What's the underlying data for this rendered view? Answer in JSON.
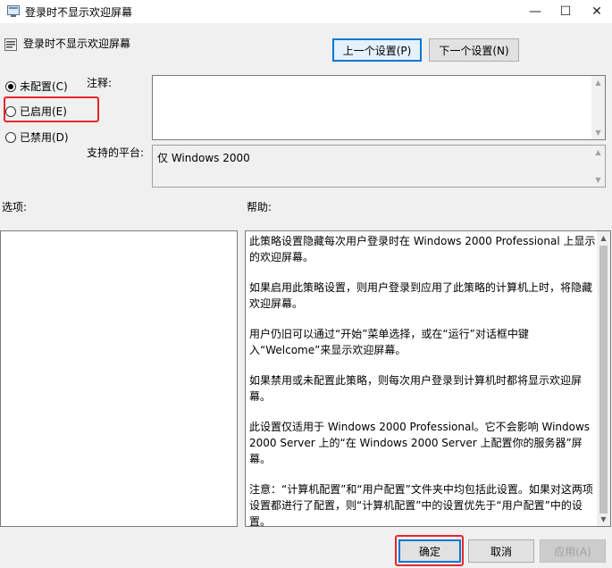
{
  "window": {
    "title": "登录时不显示欢迎屏幕",
    "controls": {
      "minimize": "—",
      "maximize": "☐",
      "close": "✕"
    }
  },
  "header": {
    "title": "登录时不显示欢迎屏幕"
  },
  "nav": {
    "prev_label": "上一个设置(P)",
    "next_label": "下一个设置(N)"
  },
  "state": {
    "options": [
      {
        "label": "未配置(C)",
        "checked": true
      },
      {
        "label": "已启用(E)",
        "checked": false
      },
      {
        "label": "已禁用(D)",
        "checked": false
      }
    ]
  },
  "labels": {
    "comment": "注释:",
    "platform": "支持的平台:",
    "options": "选项:",
    "help": "帮助:"
  },
  "platform": {
    "value": "仅 Windows 2000"
  },
  "help": {
    "paragraphs": [
      "此策略设置隐藏每次用户登录时在 Windows 2000 Professional 上显示的欢迎屏幕。",
      "如果启用此策略设置，则用户登录到应用了此策略的计算机上时，将隐藏欢迎屏幕。",
      "用户仍旧可以通过“开始”菜单选择，或在“运行”对话框中键入“Welcome”来显示欢迎屏幕。",
      "如果禁用或未配置此策略，则每次用户登录到计算机时都将显示欢迎屏幕。",
      "此设置仅适用于 Windows 2000 Professional。它不会影响 Windows 2000 Server 上的“在 Windows 2000 Server 上配置你的服务器”屏幕。",
      "注意：“计算机配置”和“用户配置”文件夹中均包括此设置。如果对这两项设置都进行了配置，则“计算机配置”中的设置优先于“用户配置”中的设置。"
    ]
  },
  "footer": {
    "ok_label": "确定",
    "cancel_label": "取消",
    "apply_label": "应用(A)"
  },
  "colors": {
    "highlight": "#e8262b",
    "accent": "#0078d7"
  }
}
